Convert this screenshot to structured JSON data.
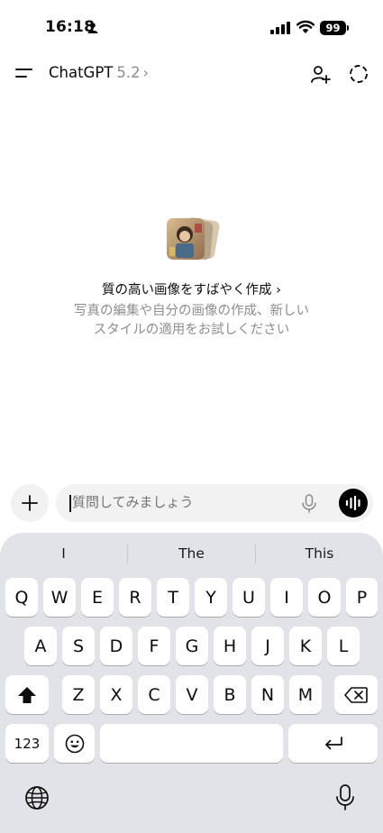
{
  "status_bar": {
    "time": "16:18",
    "battery": "99",
    "icons": [
      "person-icon",
      "signal-icon",
      "wifi-icon"
    ]
  },
  "header": {
    "app_name": "ChatGPT",
    "version": "5.2",
    "chevron": "›",
    "icons": [
      "menu-icon",
      "add-person-icon",
      "temporary-chat-icon"
    ]
  },
  "promo": {
    "title": "質の高い画像をすばやく作成 ›",
    "desc_line1": "写真の編集や自分の画像の作成、新しい",
    "desc_line2": "スタイルの適用をお試しください"
  },
  "composer": {
    "placeholder": "質問してみましょう",
    "value": "",
    "icons": [
      "plus-icon",
      "mic-icon",
      "voice-mode-icon"
    ]
  },
  "keyboard": {
    "suggestions": [
      "I",
      "The",
      "This"
    ],
    "row1": [
      "Q",
      "W",
      "E",
      "R",
      "T",
      "Y",
      "U",
      "I",
      "O",
      "P"
    ],
    "row2": [
      "A",
      "S",
      "D",
      "F",
      "G",
      "H",
      "J",
      "K",
      "L"
    ],
    "row3": [
      "Z",
      "X",
      "C",
      "V",
      "B",
      "N",
      "M"
    ],
    "numbers_label": "123",
    "icons": [
      "shift-icon",
      "delete-icon",
      "emoji-icon",
      "return-icon",
      "globe-icon",
      "dictation-mic-icon"
    ]
  }
}
